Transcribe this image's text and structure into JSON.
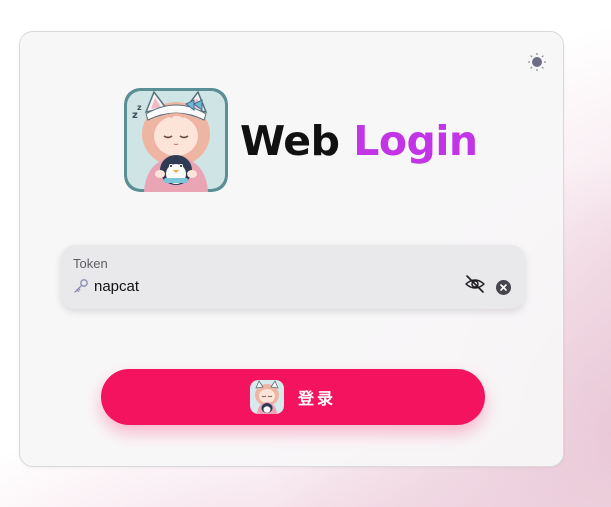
{
  "header": {
    "title_part1": "Web",
    "title_part2": "Login",
    "logo_icon": "napcat-mascot-logo",
    "theme_toggle_icon": "sun-icon"
  },
  "token_field": {
    "label": "Token",
    "value": "napcat",
    "leading_icon": "key-icon",
    "visibility_icon": "eye-off-icon",
    "clear_icon": "clear-icon"
  },
  "login_button": {
    "label": "登录",
    "icon": "napcat-avatar-icon"
  },
  "colors": {
    "accent_pink": "#f3135f",
    "title_purple": "#c135e6"
  }
}
